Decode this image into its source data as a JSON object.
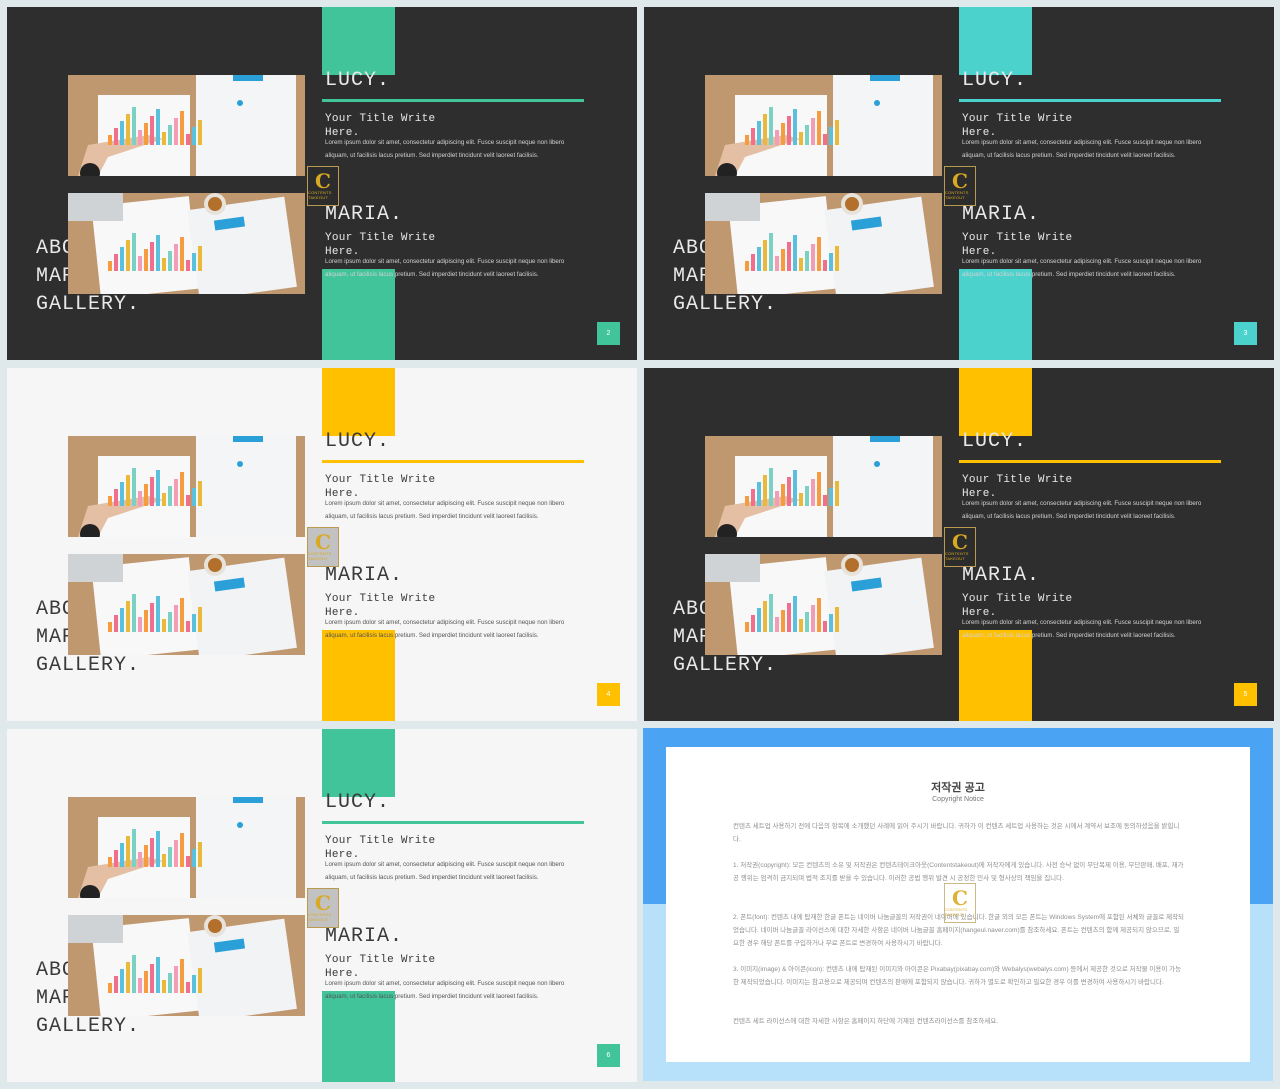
{
  "slides": [
    {
      "theme": "dark",
      "accent": "#41c49a",
      "page": "2"
    },
    {
      "theme": "dark",
      "accent": "#4cd2cd",
      "page": "3"
    },
    {
      "theme": "light",
      "accent": "#ffc000",
      "page": "4"
    },
    {
      "theme": "dark",
      "accent": "#ffc000",
      "page": "5"
    },
    {
      "theme": "light",
      "accent": "#41c49a",
      "page": "6"
    }
  ],
  "content": {
    "gallery": "ABOUT\nMARIA\nGALLERY.",
    "name1": "LUCY.",
    "name2": "MARIA.",
    "subtitle": "Your Title Write Here.",
    "body": "Lorem ipsum dolor sit amet, consectetur adipiscing elit. Fusce suscipit neque non libero aliquam, ut facilisis lacus pretium. Sed imperdiet tincidunt velit laoreet facilisis.",
    "brand_letter": "C",
    "brand_text": "CONTENTS TAKEOUT"
  },
  "notice": {
    "title": "저작권 공고",
    "subtitle": "Copyright Notice",
    "p1": "컨텐츠 세트업 사용하기 전에 다음의 항목에 소개했던 사례에 읽어 주시기 바랍니다. 귀하가 이 컨텐츠 세트업 사용하는 것은 시에서 계약서 보조에 동의하셨음을 밝힙니다.",
    "p2": "1. 저작권(copyright): 모든 컨텐츠의 소유 및 저작권은 컨텐츠테이크아웃(Contentstakeout)에 저작자에게 있습니다. 사전 승낙 없이 무단복제 이용, 무단판매, 배포, 재가공 행위는 엄격히 금지되며 법적 조치를 받을 수 있습니다. 이러한 공법 행위 발견 시 공정한 민사 및 형사상의 책임을 집니다.",
    "p3": "2. 폰트(font): 컨텐츠 내에 탑재한 한글 폰트는 네이버 나눔글꼴의 저작권이 네이버에 있습니다. 한글 외의 모든 폰트는 Windows System에 포함된 서체와 글꼴로 제작되었습니다. 네이버 나눔글꼴 라이선스에 대한 자세한 사항은 네이버 나눔글꼴 홈페이지(hangeul.naver.com)를 참조하세요. 폰트는 컨텐츠의 함께 제공되지 않으므로, 필요한 경우 해당 폰트를 구입하거나 무료 폰트로 변경하여 사용하시기 바랍니다.",
    "p4": "3. 이미지(image) & 아이콘(icon): 컨텐츠 내에 탑재된 이미지와 아이콘은 Pixabay(pixabay.com)와 Webalys(webalys.com) 등에서 제공한 것으로 저작물 이용이 가능한 제작되었습니다. 이미지는 참고용으로 제공되며 컨텐츠의 판매에 포함되지 않습니다. 귀하가 별도로 확인하고 필요한 경우 이를 변경하여 사용하시기 바랍니다.",
    "p5": "컨텐츠 세트 라이선스에 대한 자세한 사항은 홈페이지 하단에 기재된 컨텐츠라이선스를 참조하세요."
  }
}
